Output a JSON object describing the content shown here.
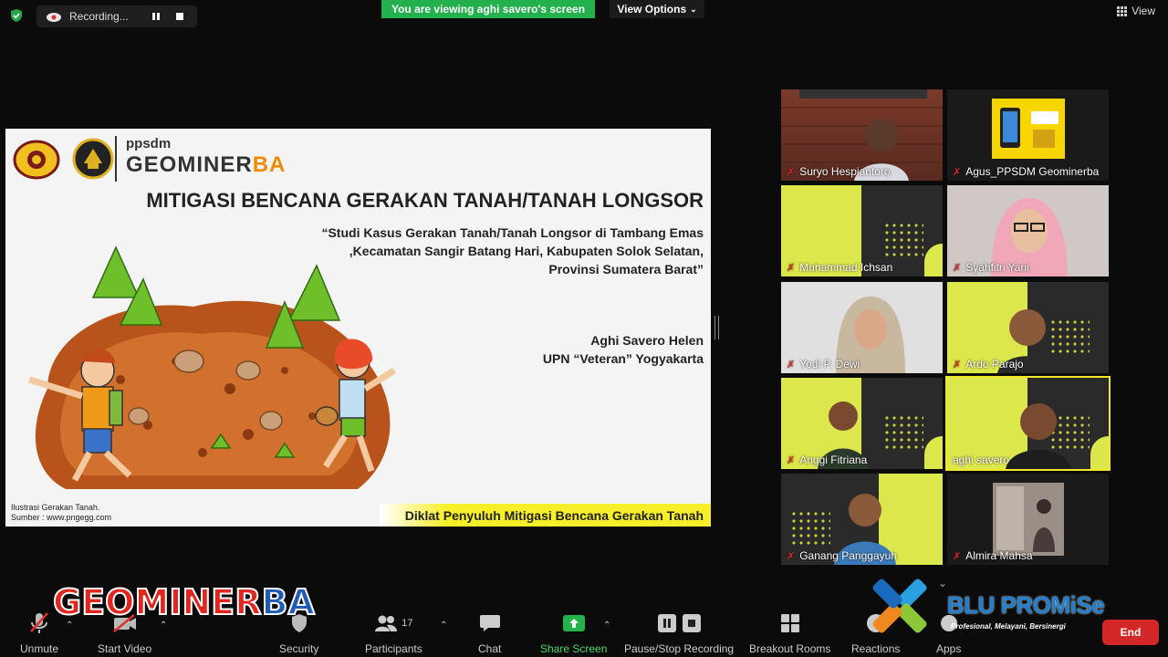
{
  "topbar": {
    "recording_label": "Recording...",
    "viewing_banner": "You are viewing aghi savero's screen",
    "view_options": "View Options",
    "view_label": "View"
  },
  "slide": {
    "ppsdm": "ppsdm",
    "brand_part1": "GEOMINER",
    "brand_part2": "BA",
    "title": "MITIGASI BENCANA GERAKAN TANAH/TANAH LONGSOR",
    "subtitle_lines": [
      "“Studi Kasus Gerakan Tanah/Tanah Longsor di Tambang Emas",
      ",Kecamatan Sangir Batang Hari, Kabupaten Solok Selatan,",
      "Provinsi Sumatera Barat”"
    ],
    "author": "Aghi Savero Helen",
    "affiliation": "UPN “Veteran” Yogyakarta",
    "caption_lines": [
      "Ilustrasi Gerakan Tanah.",
      "Sumber : www.pngegg.com"
    ],
    "footer": "Diklat  Penyuluh Mitigasi Bencana Gerakan Tanah"
  },
  "participants": [
    {
      "name": "Suryo Hespiantoro"
    },
    {
      "name": "Agus_PPSDM Geominerba"
    },
    {
      "name": "Muhammad Ichsan"
    },
    {
      "name": "Syahfitri Yani"
    },
    {
      "name": "Yodi P. Dewi"
    },
    {
      "name": "Ardo Parajo"
    },
    {
      "name": "Anggi Fitriana"
    },
    {
      "name": "aghi savero"
    },
    {
      "name": "Ganang Panggayuh"
    },
    {
      "name": "Almira Mahsa"
    }
  ],
  "toolbar": {
    "unmute": "Unmute",
    "start_video": "Start Video",
    "security": "Security",
    "participants": "Participants",
    "participants_count": "17",
    "chat": "Chat",
    "share_screen": "Share Screen",
    "pause_recording": "Pause/Stop Recording",
    "breakout_rooms": "Breakout Rooms",
    "reactions": "Reactions",
    "apps": "Apps",
    "end": "End"
  },
  "overlay": {
    "watermark": "GEOMINERBA",
    "blu_promise": "BLU PROMiSe",
    "blu_tagline": "Profesional, Melayani, Bersinergi"
  },
  "colors": {
    "zoom_green": "#22b14c",
    "end_red": "#d32727",
    "slide_yellow": "#f7ef2a",
    "brand_orange": "#f08a00"
  }
}
